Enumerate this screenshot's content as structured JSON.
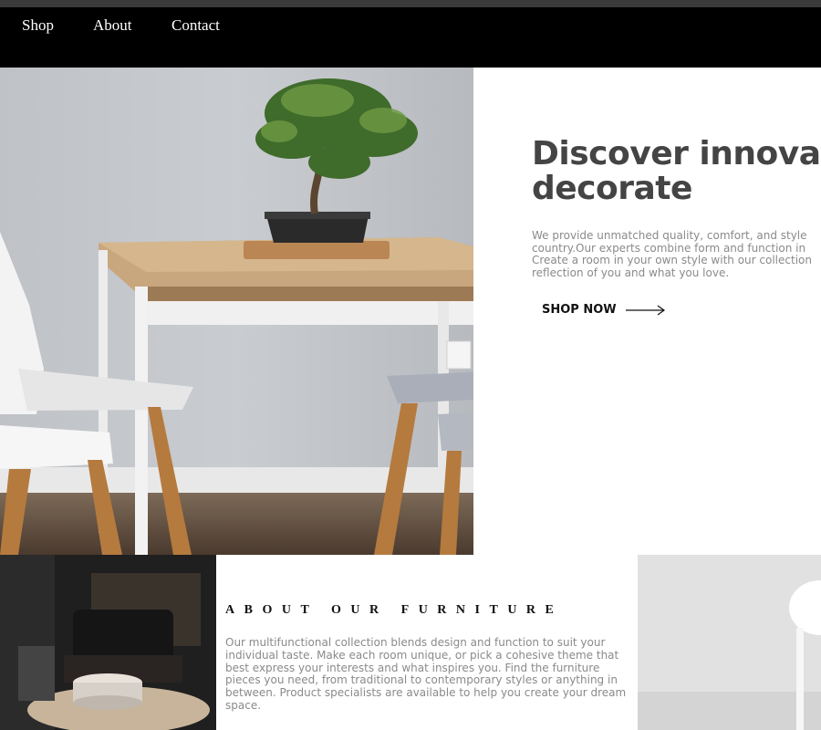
{
  "nav": {
    "items": [
      {
        "label": "Shop"
      },
      {
        "label": "About"
      },
      {
        "label": "Contact"
      }
    ]
  },
  "hero": {
    "title_line1": "Discover innovative",
    "title_line2": "decorate",
    "description_lines": [
      "We provide unmatched quality, comfort, and style",
      "country.Our experts combine form and function in",
      "Create a room in your own style with our collection",
      "reflection of you and what you love."
    ],
    "cta_label": "SHOP NOW",
    "cta_icon": "arrow-right-icon"
  },
  "about": {
    "title": "ABOUT OUR FURNITURE",
    "text": "Our multifunctional collection blends design and function to suit your individual taste. Make each room unique, or pick a cohesive theme that best express your interests and what inspires you. Find the furniture pieces you need, from traditional to contemporary styles or anything in between. Product specialists are available to help you create your dream space."
  },
  "colors": {
    "navbar_bg": "#000000",
    "title_text": "#444444",
    "body_text": "#8a8a8a"
  }
}
